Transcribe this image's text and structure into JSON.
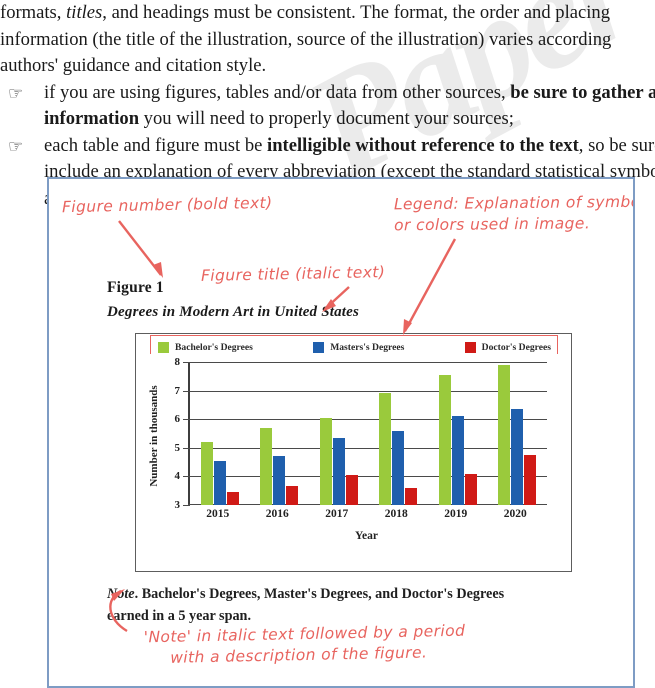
{
  "watermark": "Paper",
  "document": {
    "paragraph_lines": [
      "formats, titles, and headings must be consistent. The format, the order and placing",
      "information (the title of the illustration, source of the illustration) varies according",
      "authors' guidance and citation style."
    ],
    "paragraph_line1_a": "formats, ",
    "paragraph_line1_i": "titles",
    "paragraph_line1_b": ", and headings must be consistent. The format, the order and placing",
    "paragraph_line2": "information (the title of the illustration, source of the illustration) varies according",
    "paragraph_line3": "authors' guidance and citation style.",
    "bullet_glyph": "☞",
    "bullets": [
      {
        "line1_a": "if you are using figures, tables and/or data from other sources, ",
        "line1_bold": "be sure to gather all th",
        "line2_bold": "information",
        "line2_rest": " you will need to properly document your sources;"
      },
      {
        "line1_a": "each table and figure must be ",
        "line1_bold": "intelligible without reference to the text",
        "line1_rest": ", so be sure to",
        "line2": "include an explanation of every abbreviation (except the standard statistical symbols a",
        "line3": "abbreviations)"
      }
    ]
  },
  "annotations": {
    "figure_number": "Figure number (bold text)",
    "legend_line1": "Legend: Explanation of symbols",
    "legend_line2": "or colors used in image.",
    "figure_title": "Figure title (italic text)",
    "note_line1": "'Note' in italic text followed by a period",
    "note_line2": "with a description of the figure.",
    "marker_color": "#e8645f"
  },
  "figure": {
    "number": "Figure 1",
    "title": "Degrees in Modern Art in United States",
    "note_word": "Note",
    "note_period": ".",
    "note_line1": " Bachelor's Degrees, Master's Degrees, and Doctor's Degrees",
    "note_line2": "earned in a 5 year span."
  },
  "chart_data": {
    "type": "bar",
    "title": "Degrees in Modern Art in United States",
    "xlabel": "Year",
    "ylabel": "Number in thousands",
    "categories": [
      "2015",
      "2016",
      "2017",
      "2018",
      "2019",
      "2020"
    ],
    "ylim": [
      3,
      8
    ],
    "yticks": [
      8,
      7,
      6,
      5,
      4,
      3
    ],
    "grid": true,
    "legend_position": "top",
    "series": [
      {
        "name": "Bachelor's Degrees",
        "color": "#9ACA3C",
        "values": [
          5.2,
          5.7,
          6.05,
          6.9,
          7.55,
          7.9
        ]
      },
      {
        "name": "Masters's Degrees",
        "color": "#1F5FAD",
        "values": [
          4.55,
          4.7,
          5.35,
          5.6,
          6.1,
          6.35
        ]
      },
      {
        "name": "Doctor's Degrees",
        "color": "#D01A16",
        "values": [
          3.45,
          3.65,
          4.05,
          3.6,
          4.1,
          4.75
        ]
      }
    ]
  }
}
